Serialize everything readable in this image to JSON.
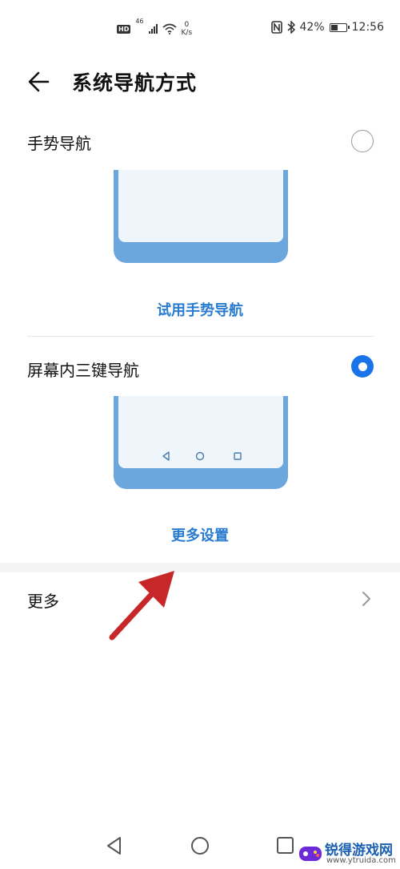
{
  "status_bar": {
    "hd_badge": "HD",
    "network_type": "46",
    "net_speed_value": "0",
    "net_speed_unit": "K/s",
    "battery": "42%",
    "time": "12:56"
  },
  "header": {
    "title": "系统导航方式"
  },
  "options": [
    {
      "label": "手势导航",
      "selected": false,
      "action": "试用手势导航"
    },
    {
      "label": "屏幕内三键导航",
      "selected": true,
      "action": "更多设置"
    }
  ],
  "more": {
    "label": "更多"
  },
  "watermark": {
    "name": "锐得游戏网",
    "url": "www.ytruida.com"
  },
  "colors": {
    "accent": "#2a7cd0",
    "radio_selected": "#1a73e8",
    "phone_frame": "#6ba6dc",
    "arrow": "#c8272a"
  }
}
